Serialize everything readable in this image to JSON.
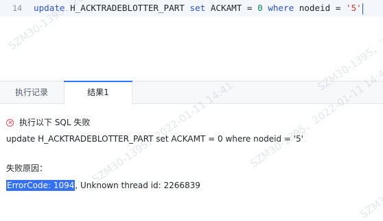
{
  "editor": {
    "line_number": "14",
    "code_tokens": [
      {
        "text": "update",
        "type": "kw"
      },
      {
        "text": " H_ACKTRADEBLOTTER_PART ",
        "type": "plain"
      },
      {
        "text": "set",
        "type": "kw"
      },
      {
        "text": " ACKAMT = ",
        "type": "plain"
      },
      {
        "text": "0",
        "type": "num"
      },
      {
        "text": " ",
        "type": "plain"
      },
      {
        "text": "where",
        "type": "kw"
      },
      {
        "text": " nodeid = ",
        "type": "plain"
      },
      {
        "text": "'5'",
        "type": "str"
      }
    ]
  },
  "tabs": {
    "history_label": "执行记录",
    "result_label": "结果1"
  },
  "result": {
    "status_text": "执行以下 SQL 失败",
    "sql": "update H_ACKTRADEBLOTTER_PART set ACKAMT = 0 where nodeid = '5'",
    "reason_label": "失败原因：",
    "error_code": "ErrorCode: 1094",
    "error_message": ", Unknown thread id: 2266839"
  },
  "watermark": {
    "text": "SZM30-1395、2022-01-11 14:41"
  },
  "colors": {
    "keyword": "#2a53c7",
    "number": "#098658",
    "string": "#c4372c",
    "error": "#e34d59",
    "accent": "#3370ff"
  },
  "icons": {
    "status": "error-circle-icon"
  }
}
